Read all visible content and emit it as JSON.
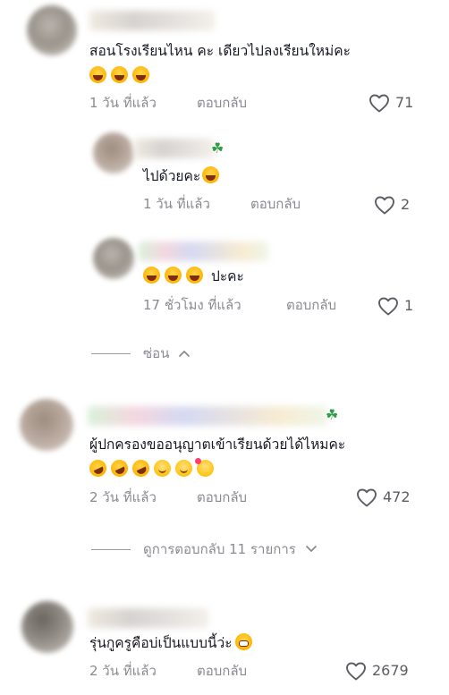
{
  "comments": [
    {
      "text": "สอนโรงเรียนไหน คะ เดียวไปลงเรียนใหม่คะ",
      "emojis": [
        "joy",
        "joy",
        "joy"
      ],
      "time": "1 วัน ที่แล้ว",
      "reply_label": "ตอบกลับ",
      "likes": "71",
      "replies": [
        {
          "text": "ไปด้วยคะ",
          "time": "1 วัน ที่แล้ว",
          "reply_label": "ตอบกลับ",
          "likes": "2"
        },
        {
          "text": "ปะคะ",
          "time": "17 ชั่วโมง ที่แล้ว",
          "reply_label": "ตอบกลับ",
          "likes": "1"
        }
      ],
      "toggle_label": "ซ่อน"
    },
    {
      "text": "ผู้ปกครองขออนุญาตเข้าเรียนด้วยได้ไหมคะ",
      "emojis": [
        "rofl",
        "rofl",
        "rofl",
        "blush",
        "blush",
        "hearts"
      ],
      "time": "2 วัน ที่แล้ว",
      "reply_label": "ตอบกลับ",
      "likes": "472",
      "toggle_label": "ดูการตอบกลับ 11 รายการ"
    },
    {
      "text": "รุ่นกูครูคือบ่เป็นแบบนี้ว่ะ",
      "time": "2 วัน ที่แล้ว",
      "reply_label": "ตอบกลับ",
      "likes": "2679"
    }
  ],
  "colors": {
    "text": "#161823",
    "muted": "#8a8b91",
    "clover": "#2e9e46"
  },
  "icons": {
    "like": "heart-outline-icon",
    "collapse": "chevron-up-icon",
    "expand": "chevron-down-icon",
    "badge": "four-leaf-clover-icon"
  }
}
